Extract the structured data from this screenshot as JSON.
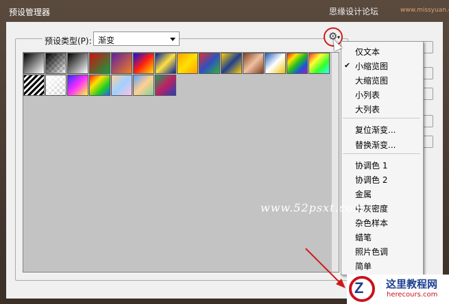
{
  "window": {
    "title": "预设管理器"
  },
  "watermark_top": {
    "text": "思缘设计论坛",
    "sub": "www.missyuan.com"
  },
  "preset": {
    "label": "预设类型(P):",
    "value": "渐变"
  },
  "menu": {
    "items": [
      {
        "label": "仅文本",
        "checked": false
      },
      {
        "label": "小缩览图",
        "checked": true
      },
      {
        "label": "大缩览图",
        "checked": false
      },
      {
        "label": "小列表",
        "checked": false
      },
      {
        "label": "大列表",
        "checked": false
      },
      {
        "label": "复位渐变...",
        "checked": false
      },
      {
        "label": "替换渐变...",
        "checked": false
      },
      {
        "label": "协调色 1",
        "checked": false
      },
      {
        "label": "协调色 2",
        "checked": false
      },
      {
        "label": "金属",
        "checked": false
      },
      {
        "label": "中灰密度",
        "checked": false
      },
      {
        "label": "杂色样本",
        "checked": false
      },
      {
        "label": "蜡笔",
        "checked": false
      },
      {
        "label": "照片色调",
        "checked": false
      },
      {
        "label": "简单",
        "checked": false
      }
    ]
  },
  "watermark_mid": "www.52psxt.com",
  "logo": {
    "title": "这里教程网",
    "url": "herecours.com"
  },
  "gradients": [
    [
      "#000000",
      "#ffffff"
    ],
    [
      "#000000",
      "transparent"
    ],
    [
      "#000000",
      "#ffffff"
    ],
    [
      "#d01010",
      "#10a040"
    ],
    [
      "#6020a0",
      "#f08020"
    ],
    [
      "#1010e0",
      "#ff2010",
      "#ffe000"
    ],
    [
      "#0020a0",
      "#ffe040",
      "#0020a0"
    ],
    [
      "#ffa000",
      "#ffe000",
      "#ffa000"
    ],
    [
      "#e03030",
      "#3050c0",
      "#30b040"
    ],
    [
      "#ffd000",
      "#204090",
      "#ffd000"
    ],
    [
      "#804020",
      "#f0c0a0",
      "#804020"
    ],
    [
      "#2060c0",
      "#ffffff",
      "#f0c000"
    ],
    [
      "#e02020",
      "#ffe000",
      "#20c020",
      "#2050e0",
      "#a020c0"
    ],
    [
      "#ff3030",
      "#ffff30",
      "#30ff30",
      "#30ffff"
    ],
    [
      "#000000",
      "#ffffff",
      "#000000",
      "#ffffff"
    ],
    [
      "#ffffff",
      "transparent"
    ],
    [
      "#3030ff",
      "#ff30ff",
      "#ffff30"
    ],
    [
      "#ff2020",
      "#ffe000",
      "#20d020",
      "#2060ff"
    ],
    [
      "#ffd0a0",
      "#a0d0ff",
      "#ffc0e0"
    ],
    [
      "#60a0ff",
      "#ffd090",
      "#80d0a0"
    ],
    [
      "#20a060",
      "#c02060",
      "#2040c0"
    ]
  ]
}
